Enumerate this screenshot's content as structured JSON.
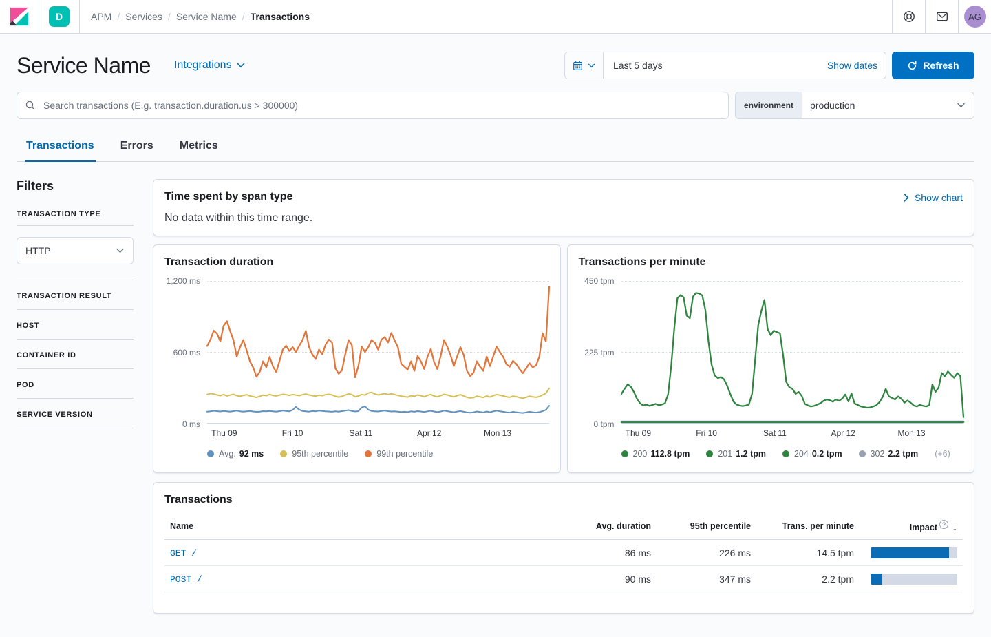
{
  "nav": {
    "space_badge": "D",
    "breadcrumbs": [
      "APM",
      "Services",
      "Service Name",
      "Transactions"
    ],
    "avatar_initials": "AG"
  },
  "header": {
    "title": "Service Name",
    "integrations_label": "Integrations",
    "time_range": "Last 5 days",
    "show_dates_label": "Show dates",
    "refresh_label": "Refresh"
  },
  "search": {
    "placeholder": "Search transactions (E.g. transaction.duration.us > 300000)"
  },
  "environment": {
    "label": "environment",
    "value": "production"
  },
  "tabs": [
    {
      "label": "Transactions"
    },
    {
      "label": "Errors"
    },
    {
      "label": "Metrics"
    }
  ],
  "filters": {
    "title": "Filters",
    "type_label": "TRANSACTION TYPE",
    "type_value": "HTTP",
    "sections": [
      "TRANSACTION RESULT",
      "HOST",
      "CONTAINER ID",
      "POD",
      "SERVICE VERSION"
    ]
  },
  "span_panel": {
    "title": "Time spent by span type",
    "message": "No data within this time range.",
    "action": "Show chart"
  },
  "chart_data": [
    {
      "type": "line",
      "title": "Transaction duration",
      "ylim": [
        0,
        1200
      ],
      "yticks": [
        "1,200 ms",
        "600 ms",
        "0 ms"
      ],
      "x_ticks": {
        "labels": [
          "Thu 09",
          "Fri 10",
          "Sat 11",
          "Apr 12",
          "Mon 13"
        ],
        "positions_pct": [
          5,
          25,
          45,
          65,
          85
        ]
      },
      "grid": "horizontal-dotted",
      "legend_position": "bottom",
      "series": [
        {
          "name": "Avg.",
          "color": "#6092C0",
          "width": 2,
          "values": [
            95,
            98,
            102,
            99,
            96,
            100,
            97,
            95,
            99,
            103,
            98,
            95,
            97,
            100,
            96,
            93,
            95,
            99,
            97,
            101,
            98,
            95,
            99,
            104,
            100,
            97,
            110,
            135,
            112,
            100,
            97,
            95,
            100,
            98,
            103,
            100,
            98,
            96,
            94,
            97,
            95,
            99,
            103,
            108,
            100,
            96,
            99,
            130,
            140,
            112,
            100,
            98,
            96,
            100,
            104,
            99,
            96,
            98,
            95,
            92,
            94,
            91,
            97,
            94,
            99,
            96,
            92,
            97,
            102,
            96,
            91,
            96,
            103,
            99,
            94,
            90,
            95,
            100,
            94,
            88,
            86,
            89,
            96,
            92,
            88,
            96,
            90,
            97,
            103,
            98,
            94,
            89,
            87,
            93,
            90,
            86,
            84,
            88,
            94,
            90,
            87,
            91,
            99,
            110,
            145
          ]
        },
        {
          "name": "95th percentile",
          "color": "#D6BF57",
          "width": 2,
          "values": [
            240,
            248,
            244,
            236,
            230,
            240,
            228,
            235,
            242,
            230,
            225,
            232,
            238,
            228,
            222,
            215,
            225,
            235,
            230,
            240,
            232,
            228,
            235,
            242,
            238,
            232,
            240,
            235,
            230,
            238,
            244,
            236,
            230,
            226,
            234,
            230,
            238,
            242,
            236,
            225,
            218,
            224,
            235,
            245,
            240,
            220,
            228,
            240,
            235,
            252,
            258,
            244,
            236,
            242,
            248,
            240,
            246,
            240,
            232,
            226,
            222,
            218,
            230,
            224,
            236,
            230,
            222,
            232,
            240,
            228,
            220,
            230,
            242,
            236,
            228,
            220,
            230,
            238,
            228,
            216,
            210,
            214,
            226,
            220,
            214,
            228,
            218,
            230,
            240,
            234,
            228,
            220,
            216,
            226,
            222,
            214,
            208,
            216,
            226,
            220,
            216,
            222,
            236,
            250,
            292
          ]
        },
        {
          "name": "99th percentile",
          "color": "#E0763C",
          "width": 2.25,
          "values": [
            650,
            705,
            780,
            755,
            690,
            820,
            860,
            775,
            700,
            560,
            640,
            700,
            615,
            520,
            468,
            390,
            432,
            520,
            470,
            558,
            478,
            430,
            522,
            620,
            652,
            608,
            640,
            600,
            652,
            700,
            778,
            640,
            578,
            540,
            620,
            580,
            660,
            705,
            678,
            460,
            415,
            445,
            580,
            700,
            658,
            385,
            480,
            645,
            600,
            640,
            700,
            678,
            620,
            705,
            725,
            680,
            760,
            698,
            640,
            500,
            475,
            450,
            520,
            440,
            565,
            520,
            455,
            560,
            625,
            515,
            455,
            565,
            700,
            645,
            575,
            480,
            560,
            640,
            575,
            440,
            395,
            425,
            520,
            475,
            440,
            560,
            480,
            565,
            645,
            600,
            558,
            495,
            475,
            525,
            498,
            455,
            420,
            460,
            505,
            470,
            485,
            560,
            758,
            688,
            1150
          ]
        }
      ],
      "legend": [
        {
          "color": "#6092C0",
          "label": "Avg.",
          "value": "92 ms"
        },
        {
          "color": "#D6BF57",
          "label": "95th percentile",
          "value": ""
        },
        {
          "color": "#E0763C",
          "label": "99th percentile",
          "value": ""
        }
      ],
      "legend_extra": ""
    },
    {
      "type": "line",
      "title": "Transactions per minute",
      "ylim": [
        0,
        450
      ],
      "yticks": [
        "450 tpm",
        "225 tpm",
        "0 tpm"
      ],
      "x_ticks": {
        "labels": [
          "Thu 09",
          "Fri 10",
          "Sat 11",
          "Apr 12",
          "Mon 13"
        ],
        "positions_pct": [
          5,
          25,
          45,
          65,
          85
        ]
      },
      "grid": "horizontal-dotted",
      "legend_position": "bottom",
      "series": [
        {
          "name": "302",
          "color": "#98A2B3",
          "width": 3,
          "values": [
            4,
            4,
            4,
            4,
            4,
            4,
            4,
            4,
            4,
            4
          ]
        },
        {
          "name": "201",
          "color": "#2E8540",
          "width": 2,
          "values": [
            2,
            2,
            2,
            2,
            2,
            2,
            2,
            2,
            2,
            2
          ]
        },
        {
          "name": "200",
          "color": "#2E8540",
          "width": 2.25,
          "values": [
            92,
            108,
            122,
            115,
            98,
            76,
            62,
            55,
            58,
            54,
            57,
            60,
            56,
            58,
            62,
            90,
            180,
            300,
            395,
            405,
            398,
            340,
            332,
            400,
            412,
            410,
            404,
            358,
            258,
            185,
            150,
            142,
            145,
            138,
            118,
            92,
            68,
            58,
            55,
            53,
            55,
            58,
            92,
            200,
            310,
            355,
            390,
            298,
            278,
            292,
            288,
            284,
            215,
            130,
            113,
            108,
            92,
            98,
            85,
            60,
            55,
            52,
            54,
            58,
            62,
            70,
            74,
            72,
            67,
            74,
            70,
            77,
            90,
            68,
            93,
            61,
            57,
            52,
            50,
            48,
            49,
            52,
            56,
            66,
            82,
            108,
            84,
            79,
            74,
            84,
            77,
            64,
            71,
            64,
            55,
            52,
            57,
            54,
            52,
            56,
            122,
            98,
            112,
            158,
            148,
            163,
            152,
            143,
            158,
            148,
            18
          ]
        }
      ],
      "legend": [
        {
          "color": "#2E8540",
          "label": "200",
          "value": "112.8 tpm"
        },
        {
          "color": "#2E8540",
          "label": "201",
          "value": "1.2 tpm"
        },
        {
          "color": "#2E8540",
          "label": "204",
          "value": "0.2 tpm"
        },
        {
          "color": "#98A2B3",
          "label": "302",
          "value": "2.2 tpm"
        }
      ],
      "legend_extra": "(+6)"
    }
  ],
  "table": {
    "title": "Transactions",
    "columns": [
      "Name",
      "Avg. duration",
      "95th percentile",
      "Trans. per minute",
      "Impact"
    ],
    "rows": [
      {
        "name": "GET /",
        "avg": "86 ms",
        "p95": "226 ms",
        "tpm": "14.5 tpm",
        "impact_pct": 90
      },
      {
        "name": "POST /",
        "avg": "90 ms",
        "p95": "347 ms",
        "tpm": "2.2 tpm",
        "impact_pct": 13
      }
    ]
  }
}
